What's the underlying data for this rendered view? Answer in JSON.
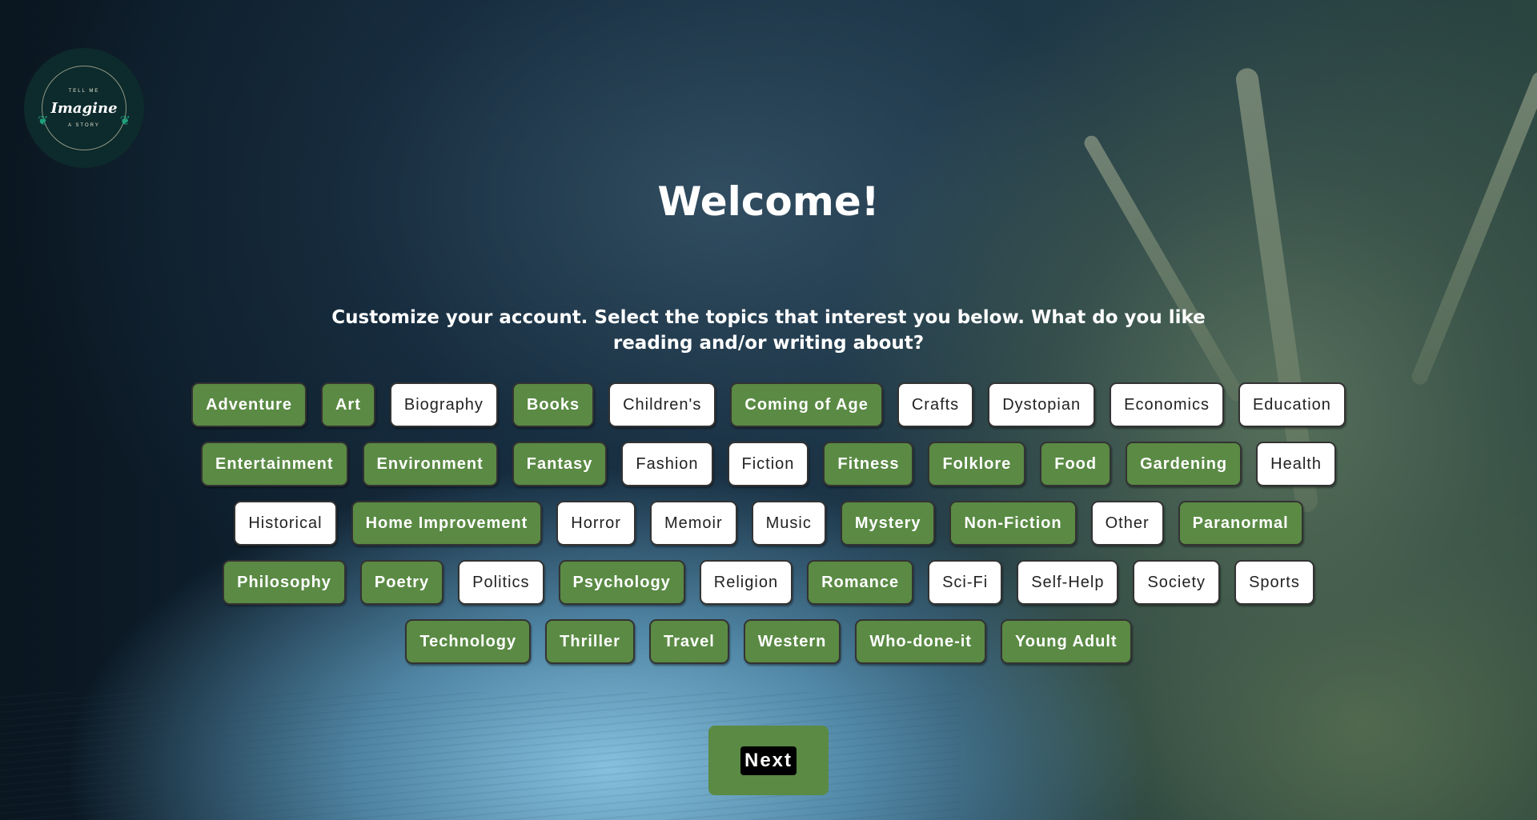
{
  "logo": {
    "top_text": "TELL ME",
    "word": "Imagine",
    "bottom_text": "A STORY"
  },
  "header": {
    "title": "Welcome!",
    "subtitle": "Customize your account. Select the topics that interest you below. What do you like reading and/or writing about?"
  },
  "colors": {
    "selected": "#5a8a44",
    "unselected": "#ffffff"
  },
  "topic_rows": [
    [
      {
        "label": "Adventure",
        "selected": true
      },
      {
        "label": "Art",
        "selected": true
      },
      {
        "label": "Biography",
        "selected": false
      },
      {
        "label": "Books",
        "selected": true
      },
      {
        "label": "Children's",
        "selected": false
      },
      {
        "label": "Coming of Age",
        "selected": true
      },
      {
        "label": "Crafts",
        "selected": false
      },
      {
        "label": "Dystopian",
        "selected": false
      },
      {
        "label": "Economics",
        "selected": false
      },
      {
        "label": "Education",
        "selected": false
      }
    ],
    [
      {
        "label": "Entertainment",
        "selected": true
      },
      {
        "label": "Environment",
        "selected": true
      },
      {
        "label": "Fantasy",
        "selected": true
      },
      {
        "label": "Fashion",
        "selected": false
      },
      {
        "label": "Fiction",
        "selected": false
      },
      {
        "label": "Fitness",
        "selected": true
      },
      {
        "label": "Folklore",
        "selected": true
      },
      {
        "label": "Food",
        "selected": true
      },
      {
        "label": "Gardening",
        "selected": true
      },
      {
        "label": "Health",
        "selected": false
      }
    ],
    [
      {
        "label": "Historical",
        "selected": false
      },
      {
        "label": "Home Improvement",
        "selected": true
      },
      {
        "label": "Horror",
        "selected": false
      },
      {
        "label": "Memoir",
        "selected": false
      },
      {
        "label": "Music",
        "selected": false
      },
      {
        "label": "Mystery",
        "selected": true
      },
      {
        "label": "Non-Fiction",
        "selected": true
      },
      {
        "label": "Other",
        "selected": false
      },
      {
        "label": "Paranormal",
        "selected": true
      }
    ],
    [
      {
        "label": "Philosophy",
        "selected": true
      },
      {
        "label": "Poetry",
        "selected": true
      },
      {
        "label": "Politics",
        "selected": false
      },
      {
        "label": "Psychology",
        "selected": true
      },
      {
        "label": "Religion",
        "selected": false
      },
      {
        "label": "Romance",
        "selected": true
      },
      {
        "label": "Sci-Fi",
        "selected": false
      },
      {
        "label": "Self-Help",
        "selected": false
      },
      {
        "label": "Society",
        "selected": false
      },
      {
        "label": "Sports",
        "selected": false
      }
    ],
    [
      {
        "label": "Technology",
        "selected": true
      },
      {
        "label": "Thriller",
        "selected": true
      },
      {
        "label": "Travel",
        "selected": true
      },
      {
        "label": "Western",
        "selected": true
      },
      {
        "label": "Who-done-it",
        "selected": true
      },
      {
        "label": "Young Adult",
        "selected": true
      }
    ]
  ],
  "actions": {
    "next_label": "Next"
  }
}
